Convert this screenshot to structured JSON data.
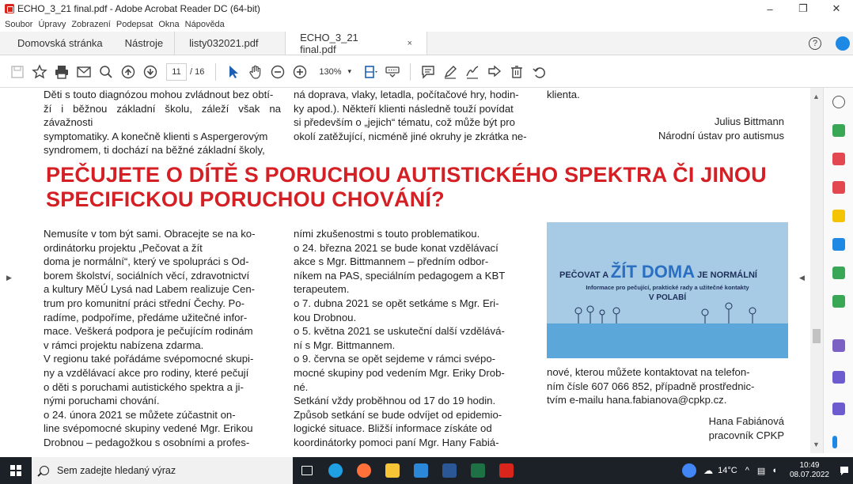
{
  "window": {
    "title": "ECHO_3_21 final.pdf - Adobe Acrobat Reader DC (64-bit)",
    "controls": {
      "minimize": "–",
      "restore": "❐",
      "close": "✕"
    }
  },
  "menubar": [
    "Soubor",
    "Úpravy",
    "Zobrazení",
    "Podepsat",
    "Okna",
    "Nápověda"
  ],
  "tabs": {
    "home": "Domovská stránka",
    "tools": "Nástroje",
    "docs": [
      {
        "label": "listy032021.pdf",
        "active": false
      },
      {
        "label": "ECHO_3_21 final.pdf",
        "active": true,
        "close": "×"
      }
    ],
    "help": "?"
  },
  "toolbar": {
    "page_current": "11",
    "page_total": "/ 16",
    "zoom": "130%",
    "zoom_chevron": "▾"
  },
  "document": {
    "top_col1": "Děti s touto diagnózou mohou zvládnout bez obtí-\nží i běžnou základní školu, záleží však na závažnosti\nsymptomatiky. A konečně klienti s Aspergerovým\nsyndromem, ti dochází na běžné základní školy,",
    "top_col2": "ná doprava, vlaky, letadla, počítačové hry, hodin-\nky apod.). Někteří klienti následně touží povídat\nsi především o „jejich“ tématu, což může být pro\nokolí zatěžující, nicméně jiné okruhy je zkrátka ne-",
    "top_col3": "klienta.",
    "sig1_name": "Julius Bittmann",
    "sig1_org": "Národní ústav pro autismus",
    "heading_line1": "PEČUJETE O DÍTĚ S PORUCHOU  AUTISTICKÉHO SPEKTRA ČI JINOU",
    "heading_line2": "SPECIFICKOU PORUCHOU CHOVÁNÍ?",
    "body_col1": "Nemusíte v tom být sami. Obracejte se na ko-\nordinátorku projektu „Pečovat a žít\ndoma je normální“, který ve spolupráci s Od-\nborem školství, sociálních věcí, zdravotnictví\na kultury MěÚ Lysá nad Labem realizuje Cen-\ntrum pro komunitní práci střední Čechy. Po-\nradíme, podpoříme, předáme užitečné infor-\nmace. Veškerá podpora je pečujícím rodinám\nv rámci projektu nabízena zdarma.\nV regionu také pořádáme svépomocné skupi-\nny a vzdělávací akce pro rodiny, které pečují\no děti s poruchami autistického spektra a ji-\nnými poruchami chování.\no  24. února 2021 se můžete zúčastnit on-\nline svépomocné skupiny vedené Mgr. Erikou\nDrobnou – pedagožkou s osobními a profes-",
    "body_col2": "ními zkušenostmi s touto problematikou.\no  24. března 2021 se bude konat vzdělávací\nakce s Mgr. Bittmannem – předním odbor-\nníkem na PAS, speciálním pedagogem a KBT\nterapeutem.\no  7. dubna 2021 se opět setkáme s Mgr. Eri-\nkou Drobnou.\no  5. května 2021 se uskuteční další vzdělává-\nní s Mgr. Bittmannem.\no  9. června se opět sejdeme v rámci svépo-\nmocné skupiny pod vedením Mgr. Eriky Drob-\nné.\nSetkání vždy proběhnou od 17 do 19 hodin.\nZpůsob setkání se bude odvíjet od epidemio-\nlogické situace.  Bližší informace získáte od\nkoordinátorky pomoci paní Mgr. Hany Fabiá-",
    "body_col3": "nové, kterou můžete kontaktovat na telefon-\nním čísle 607 066 852, případně prostřednic-\ntvím e-mailu hana.fabianova@cpkp.cz.",
    "sig2_name": "Hana Fabiánová",
    "sig2_org": "pracovník CPKP",
    "promo": {
      "title_a": "PEČOVAT A ",
      "title_b": "ŽÍT DOMA",
      "title_c": " JE NORMÁLNÍ",
      "subtitle": "Informace pro pečující, praktické rady a užitečné kontakty",
      "region": "V POLABÍ"
    }
  },
  "taskbar": {
    "search_placeholder": "Sem zadejte hledaný výraz",
    "temperature": "14°C",
    "time": "10:49",
    "date": "08.07.2022"
  },
  "colors": {
    "heading_red": "#d42024",
    "acrobat_red": "#d9251c",
    "taskbar_bg": "#1c2128"
  }
}
